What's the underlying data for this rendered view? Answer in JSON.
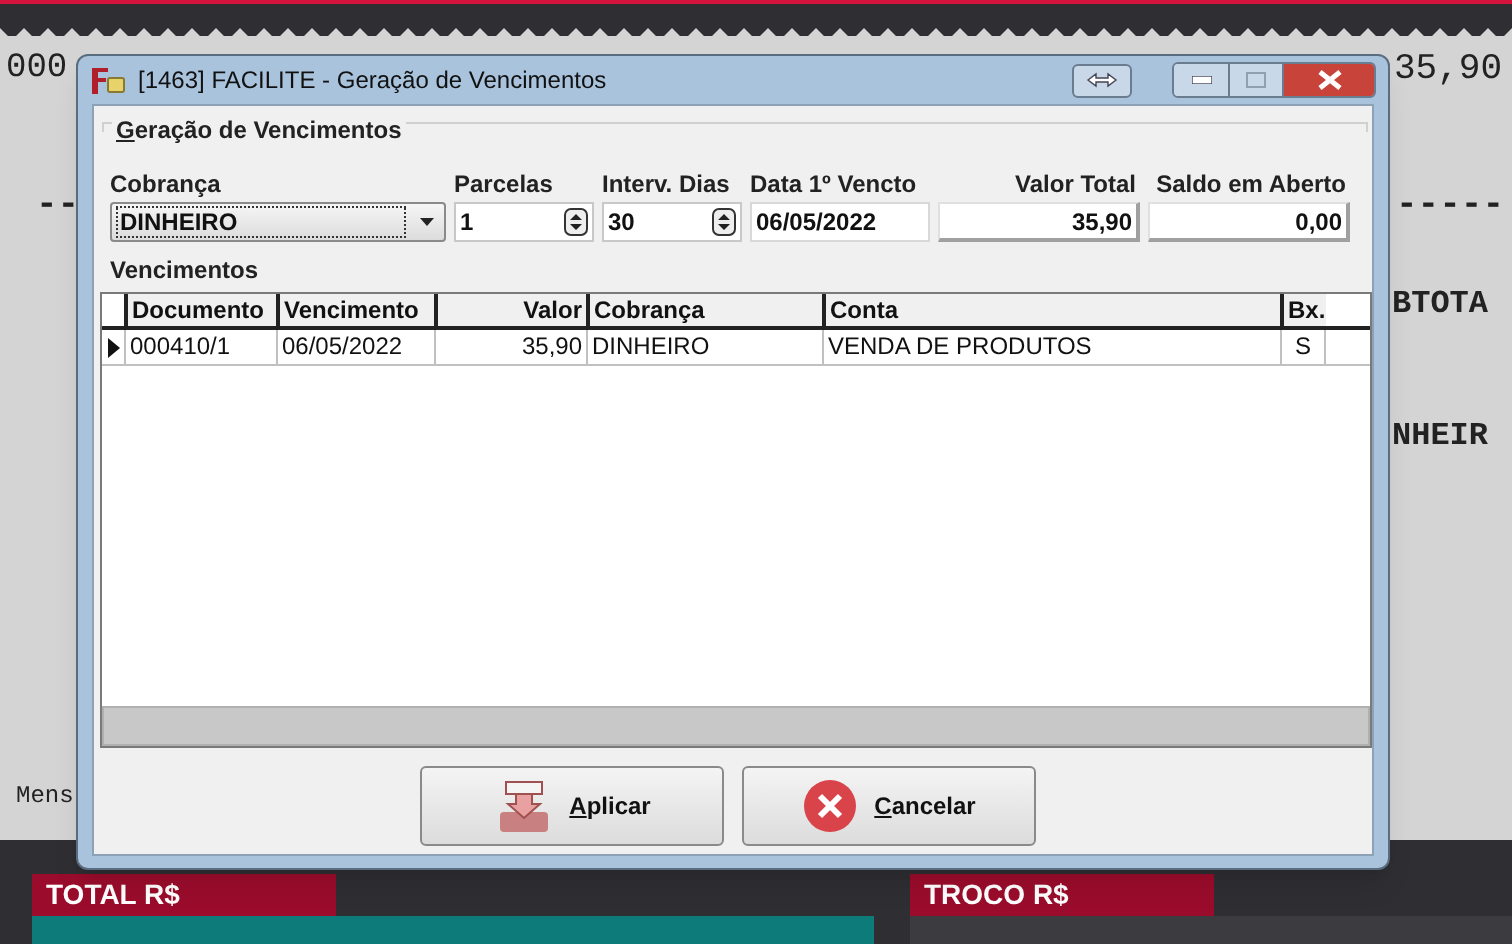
{
  "receipt": {
    "texts": [
      {
        "kind": "code",
        "text": "000"
      },
      {
        "kind": "amount",
        "text": "35,90"
      },
      {
        "kind": "dashes_left",
        "text": "--"
      },
      {
        "kind": "dashes_right",
        "text": "-----"
      },
      {
        "kind": "subtotal",
        "text": "BTOTA"
      },
      {
        "kind": "payment",
        "text": "NHEIR"
      },
      {
        "kind": "message",
        "text": "Mens"
      }
    ]
  },
  "totals": [
    {
      "label": "TOTAL R$",
      "kind": "total"
    },
    {
      "label": "TROCO R$",
      "kind": "change"
    }
  ],
  "dialog": {
    "title": "[1463] FACILITE - Geração de Vencimentos",
    "group": {
      "title": "Geração de Vencimentos"
    },
    "fields": [
      {
        "label": "Cobrança",
        "kind": "combo",
        "value": "DINHEIRO"
      },
      {
        "label": "Parcelas",
        "kind": "spin",
        "value": "1"
      },
      {
        "label": "Interv. Dias",
        "kind": "spin",
        "value": "30"
      },
      {
        "label": "Data 1º Vencto",
        "kind": "date",
        "value": "06/05/2022"
      },
      {
        "label": "Valor Total",
        "kind": "readonly",
        "value": "35,90"
      },
      {
        "label": "Saldo em Aberto",
        "kind": "readonly",
        "value": "0,00"
      }
    ],
    "table": {
      "title": "Vencimentos",
      "columns": [
        "Documento",
        "Vencimento",
        "Valor",
        "Cobrança",
        "Conta",
        "Bx."
      ],
      "rows": [
        {
          "selected": true,
          "cells": [
            "000410/1",
            "06/05/2022",
            "35,90",
            "DINHEIRO",
            "VENDA DE PRODUTOS",
            "S"
          ]
        }
      ]
    },
    "buttons": [
      {
        "label": "Aplicar",
        "kind": "apply"
      },
      {
        "label": "Cancelar",
        "kind": "cancel"
      }
    ]
  }
}
